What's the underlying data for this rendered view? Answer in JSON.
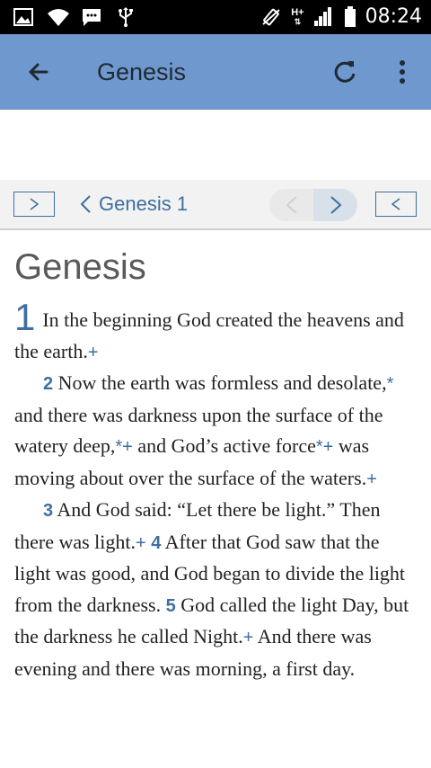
{
  "status_bar": {
    "time": "08:24",
    "network_type": "H+",
    "icons": [
      "image-notification-icon",
      "wifi-icon",
      "message-icon",
      "usb-icon",
      "vibrate-icon",
      "signal-icon",
      "battery-icon"
    ]
  },
  "app_bar": {
    "title": "Genesis",
    "icons": [
      "back-arrow-icon",
      "refresh-icon",
      "more-vert-icon"
    ]
  },
  "nav": {
    "left_toggle": ">",
    "chapter_label": "Genesis 1",
    "right_toggle": "<"
  },
  "content": {
    "book_heading": "Genesis",
    "chapter_number": "1",
    "verses": {
      "v1": "In the beginning God created the heavens and the earth.",
      "v2_num": "2",
      "v2_a": "Now the earth was formless and desolate,",
      "v2_b": " and there was darkness upon the surface of the watery deep,",
      "v2_c": " and God’s active force",
      "v2_d": " was moving about over the surface of the waters.",
      "v3_num": "3",
      "v3": "And God said: “Let there be light.” Then there was light.",
      "v4_num": "4",
      "v4": "After that God saw that the light was good, and God began to divide the light from the darkness.",
      "v5_num": "5",
      "v5_a": "God called the light Day, but the darkness he called Night.",
      "v5_b": " And there was evening and there was morning, a first day."
    },
    "markers": {
      "plus": "+",
      "star": "*",
      "star_plus": "*+"
    }
  },
  "colors": {
    "app_bar": "#6f98cf",
    "accent": "#3d6fa0",
    "status_bar": "#000000"
  }
}
